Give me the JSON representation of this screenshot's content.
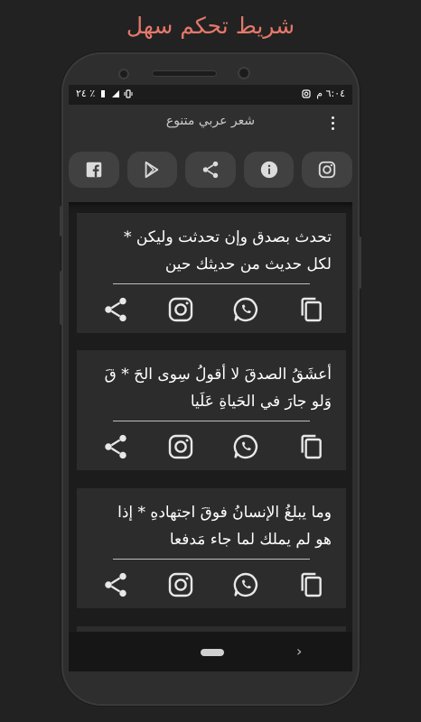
{
  "promo": {
    "title": "شريط تحكم سهل"
  },
  "status_bar": {
    "time": "٦:٠٤ م",
    "battery": "٢٤ ٪"
  },
  "app": {
    "title": "شعر عربي متنوع"
  },
  "toolbar": {
    "items": [
      {
        "icon": "facebook-icon"
      },
      {
        "icon": "google-play-icon"
      },
      {
        "icon": "share-icon"
      },
      {
        "icon": "info-icon"
      },
      {
        "icon": "instagram-icon"
      }
    ]
  },
  "cards": [
    {
      "line1": "تحدث بصدق وإن تحدثت وليكن *",
      "line2": "لكل حديث من حديثك حين"
    },
    {
      "line1": "أعشَقُ الصدقَ لا أقولُ سِوى الحَ * قَ",
      "line2": "وَلو جارَ في الحَياةِ عَلَيا"
    },
    {
      "line1": "وما يبلغُ الإنسانُ فوقَ اجتهادهِ * إذا",
      "line2": "هو لم يملك لما جاء مَدفعا"
    }
  ],
  "card_actions": [
    "share-icon",
    "instagram-icon",
    "whatsapp-icon",
    "copy-icon"
  ],
  "colors": {
    "accent": "#e4786b",
    "background": "#222222",
    "card": "#2c2c2c",
    "appbar": "#2f2f2f"
  }
}
